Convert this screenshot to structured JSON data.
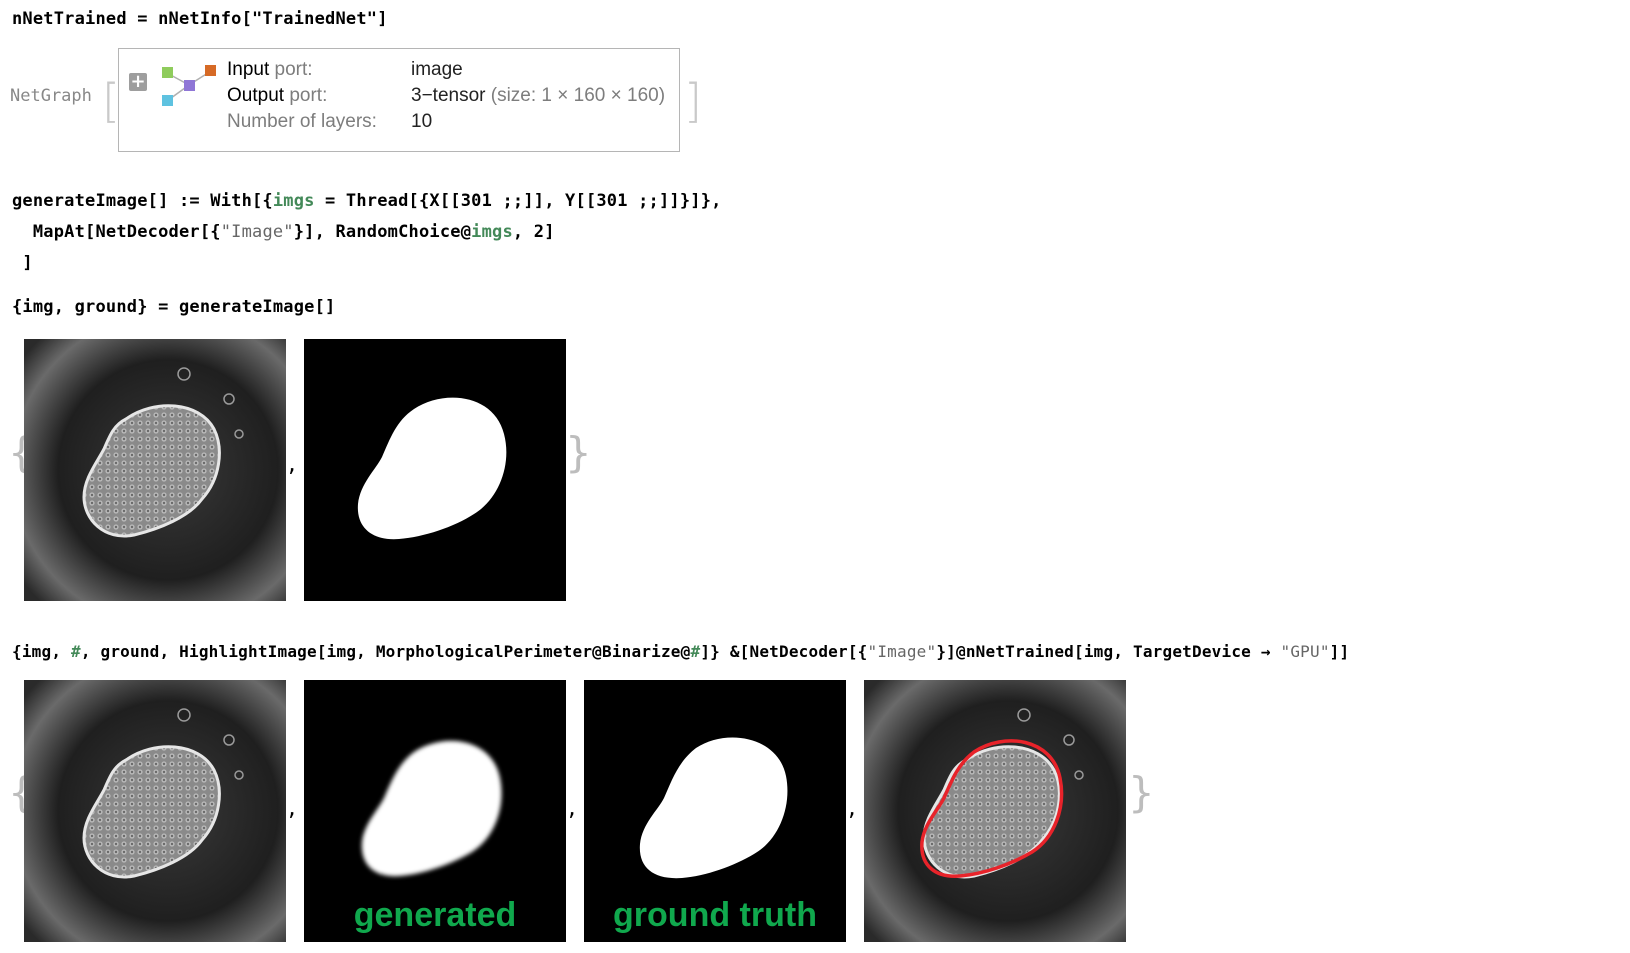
{
  "cell1": {
    "input": "nNetTrained = nNetInfo[\"TrainedNet\"]",
    "out_head": "NetGraph",
    "rows": [
      {
        "key_strong": "Input",
        "key_light": " port:",
        "value": "image",
        "value_extra": ""
      },
      {
        "key_strong": "Output",
        "key_light": " port:",
        "value": "3−tensor",
        "value_extra": " (size: 1 × 160 × 160)"
      },
      {
        "key_strong": "",
        "key_light": "Number of layers:",
        "value": "10",
        "value_extra": ""
      }
    ]
  },
  "cell2": {
    "line1a": "generateImage[] := With[{",
    "line1b": "imgs",
    "line1c": " = Thread[{X[[301 ;;]], Y[[301 ;;]]}]},",
    "line2a": "  MapAt[NetDecoder[{",
    "line2b": "\"Image\"",
    "line2c": "}], RandomChoice@",
    "line2d": "imgs",
    "line2e": ", 2]",
    "line3": " ]"
  },
  "cell3": {
    "input": "{img, ground} = generateImage[]"
  },
  "cell4": {
    "a": "{img, ",
    "b": "#",
    "c": ", ground, HighlightImage[img, MorphologicalPerimeter@Binarize@",
    "d": "#",
    "e": "]} &[NetDecoder[{",
    "f": "\"Image\"",
    "g": "}]@nNetTrained[img, TargetDevice → ",
    "h": "\"GPU\"",
    "i": "]]"
  },
  "captions": {
    "generated": "generated",
    "ground_truth": "ground truth"
  },
  "colors": {
    "caption": "#10a84d",
    "contour": "#e8232a",
    "symbol": "#438958"
  }
}
